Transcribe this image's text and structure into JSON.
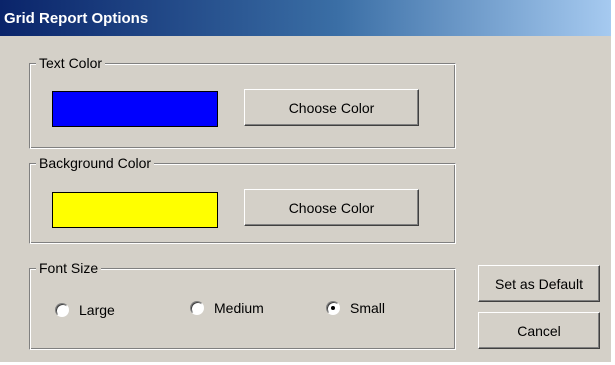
{
  "window": {
    "title": "Grid Report Options"
  },
  "text_color_group": {
    "legend": "Text Color",
    "swatch_color": "#0000ff",
    "choose_label": "Choose Color"
  },
  "background_color_group": {
    "legend": "Background Color",
    "swatch_color": "#ffff00",
    "choose_label": "Choose Color"
  },
  "font_size_group": {
    "legend": "Font Size",
    "options": [
      {
        "label": "Large",
        "selected": false
      },
      {
        "label": "Medium",
        "selected": false
      },
      {
        "label": "Small",
        "selected": true
      }
    ]
  },
  "buttons": {
    "set_default_label": "Set as Default",
    "cancel_label": "Cancel"
  }
}
